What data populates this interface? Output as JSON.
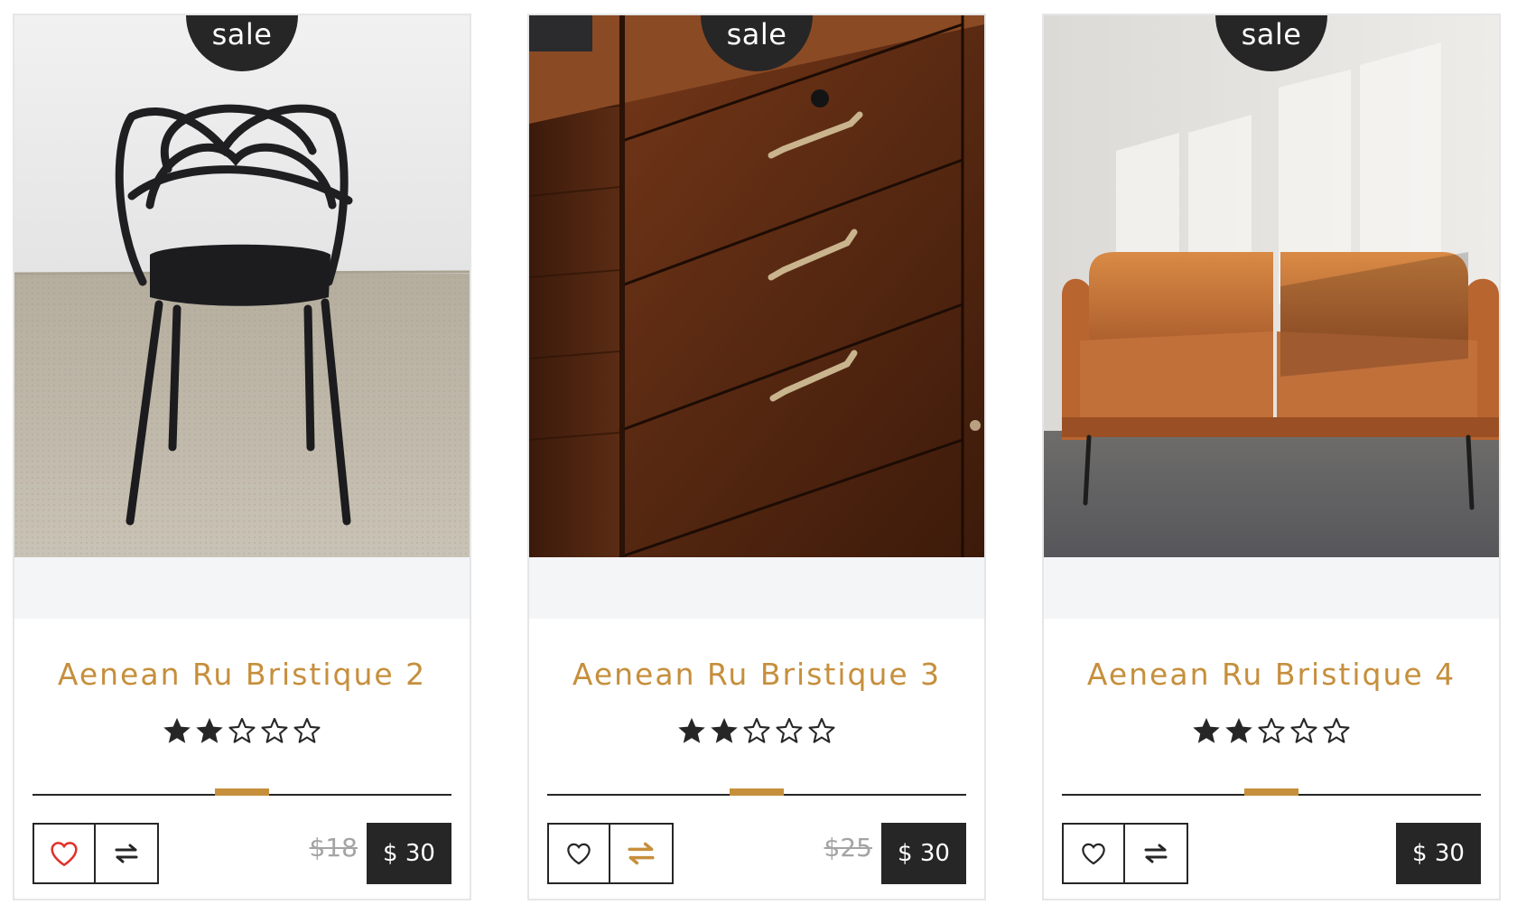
{
  "products": [
    {
      "badge": "sale",
      "title": "Aenean Ru Bristique 2",
      "rating": 2,
      "max_rating": 5,
      "old_price": "$18",
      "price": "$ 30",
      "image": "black-chair-photo",
      "wishlist_active": true,
      "compare_active": false
    },
    {
      "badge": "sale",
      "title": "Aenean Ru Bristique 3",
      "rating": 2,
      "max_rating": 5,
      "old_price": "$25",
      "price": "$ 30",
      "image": "wooden-dresser-photo",
      "wishlist_active": false,
      "compare_active": true
    },
    {
      "badge": "sale",
      "title": "Aenean Ru Bristique 4",
      "rating": 2,
      "max_rating": 5,
      "old_price": "",
      "price": "$ 30",
      "image": "leather-sofa-photo",
      "wishlist_active": false,
      "compare_active": false
    }
  ],
  "colors": {
    "accent": "#c68f3c",
    "dark": "#262626",
    "wishlist_active": "#e0302a",
    "muted_price": "#a4a4a4",
    "band": "#f4f5f7"
  },
  "icons": {
    "wishlist": "heart-icon",
    "compare": "swap-arrows-icon",
    "rating_full": "star-filled-icon",
    "rating_empty": "star-outline-icon"
  }
}
